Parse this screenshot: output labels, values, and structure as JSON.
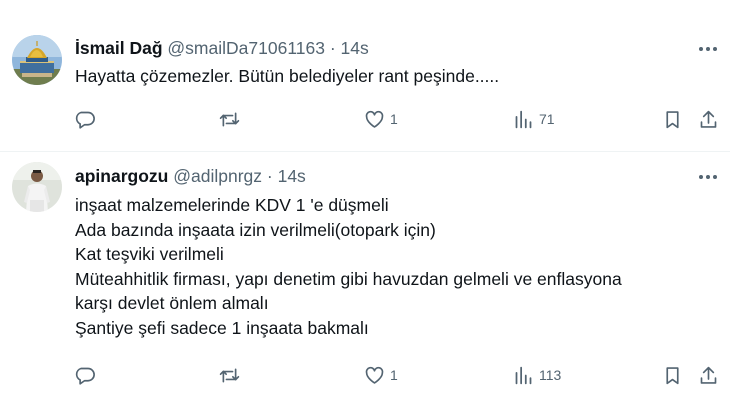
{
  "tweets": [
    {
      "name": "İsmail Dağ",
      "handle": "@smailDa71061163",
      "sep": "·",
      "time": "14s",
      "lines": [
        "Hayatta çözemezler. Bütün belediyeler rant peşinde....."
      ],
      "replies": "",
      "retweets": "",
      "likes": "1",
      "views": "71"
    },
    {
      "name": "apinargozu",
      "handle": "@adilpnrgz",
      "sep": "·",
      "time": "14s",
      "lines": [
        "inşaat malzemelerinde KDV 1 'e düşmeli",
        "Ada bazında inşaata izin verilmeli(otopark için)",
        "Kat teşviki verilmeli",
        "Müteahhitlik firması, yapı denetim gibi havuzdan gelmeli ve enflasyona",
        "karşı devlet önlem almalı",
        "Şantiye şefi sadece 1 inşaata bakmalı"
      ],
      "replies": "",
      "retweets": "",
      "likes": "1",
      "views": "113"
    }
  ],
  "icons": {
    "more": "more-horizontal-icon",
    "reply": "reply-bubble-icon",
    "retweet": "retweet-icon",
    "like": "heart-icon",
    "views": "analytics-bars-icon",
    "bookmark": "bookmark-icon",
    "share": "share-upload-icon"
  },
  "colors": {
    "text": "#0f1419",
    "secondary": "#536471",
    "divider": "#eff3f4"
  }
}
